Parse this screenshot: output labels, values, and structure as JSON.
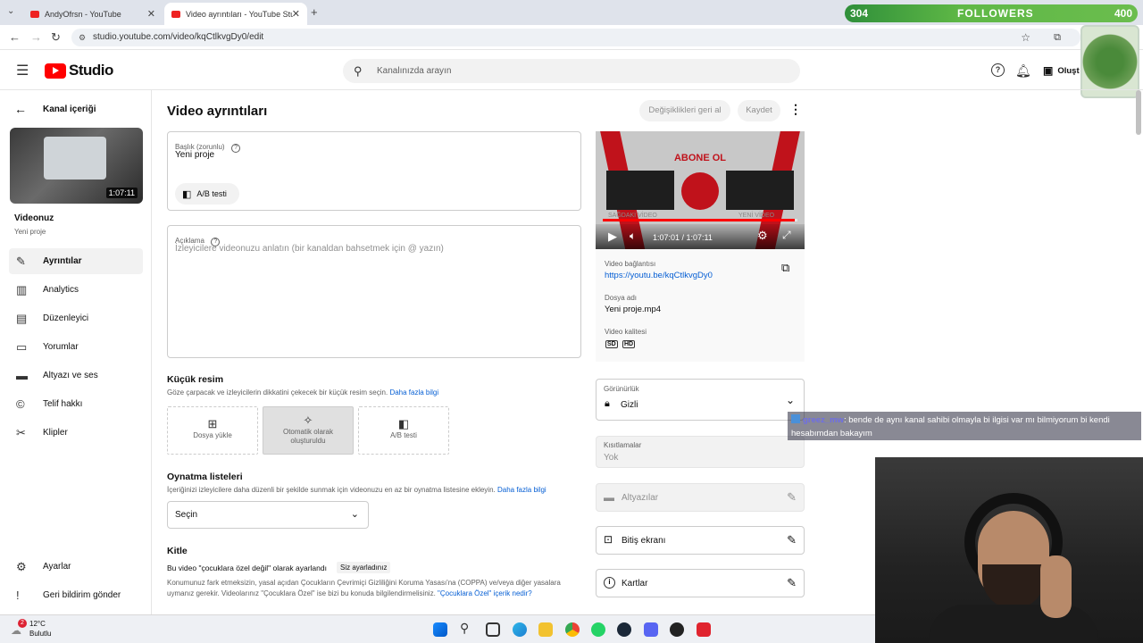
{
  "browser": {
    "tabs": [
      {
        "title": "AndyOfrsn - YouTube"
      },
      {
        "title": "Video ayrıntıları - YouTube Studi"
      }
    ],
    "url": "studio.youtube.com/video/kqCtlkvgDy0/edit"
  },
  "overlay": {
    "followers_count": "304",
    "followers_label": "FOLLOWERS",
    "followers_goal": "400"
  },
  "header": {
    "logo_text": "Studio",
    "search_placeholder": "Kanalınızda arayın",
    "create_label": "Oluşt"
  },
  "sidebar": {
    "back_label": "Kanal içeriği",
    "thumb_duration": "1:07:11",
    "video_title": "Videonuz",
    "video_subtitle": "Yeni proje",
    "items": [
      {
        "label": "Ayrıntılar",
        "icon": "pencil-icon"
      },
      {
        "label": "Analytics",
        "icon": "analytics-icon"
      },
      {
        "label": "Düzenleyici",
        "icon": "editor-icon"
      },
      {
        "label": "Yorumlar",
        "icon": "comments-icon"
      },
      {
        "label": "Altyazı ve ses",
        "icon": "subtitles-icon"
      },
      {
        "label": "Telif hakkı",
        "icon": "copyright-icon"
      },
      {
        "label": "Klipler",
        "icon": "scissors-icon"
      }
    ],
    "settings_label": "Ayarlar",
    "feedback_label": "Geri bildirim gönder"
  },
  "main": {
    "page_title": "Video ayrıntıları",
    "undo_label": "Değişiklikleri geri al",
    "save_label": "Kaydet",
    "title_field_label": "Başlık (zorunlu)",
    "title_value": "Yeni proje",
    "ab_test_label": "A/B testi",
    "description_label": "Açıklama",
    "description_placeholder": "İzleyicilere videonuzu anlatın (bir kanaldan bahsetmek için @ yazın)",
    "thumbnail_title": "Küçük resim",
    "thumbnail_sub": "Göze çarpacak ve izleyicilerin dikkatini çekecek bir küçük resim seçin.",
    "learn_more": "Daha fazla bilgi",
    "thumb_upload_label": "Dosya yükle",
    "thumb_auto_label": "Otomatik olarak oluşturuldu",
    "thumb_ab_label": "A/B testi",
    "playlists_title": "Oynatma listeleri",
    "playlists_sub": "İçeriğinizi izleyicilere daha düzenli bir şekilde sunmak için videonuzu en az bir oynatma listesine ekleyin.",
    "playlists_select": "Seçin",
    "audience_title": "Kitle",
    "audience_status": "Bu video \"çocuklara özel değil\" olarak ayarlandı",
    "audience_badge": "Siz ayarladınız",
    "audience_text": "Konumunuz fark etmeksizin, yasal açıdan Çocukların Çevrimiçi Gizliliğini Koruma Yasası'na (COPPA) ve/veya diğer yasalara uymanız gerekir. Videolarınız \"Çocuklara Özel\" ise bizi bu konuda bilgilendirmelisiniz.",
    "audience_link": "\"Çocuklara Özel\" içerik nedir?"
  },
  "right": {
    "player_overlay_title": "ABONE OL",
    "player_left_caption": "SAĞDAKİ VİDEO",
    "player_right_caption": "YENİ VİDEO",
    "player_time": "1:07:01 / 1:07:11",
    "player_progress": 0.985,
    "video_link_label": "Video bağlantısı",
    "video_link": "https://youtu.be/kqCtlkvgDy0",
    "filename_label": "Dosya adı",
    "filename": "Yeni proje.mp4",
    "quality_label": "Video kalitesi",
    "quality_badges": [
      "SD",
      "HD"
    ],
    "visibility_label": "Görünürlük",
    "visibility_value": "Gizli",
    "restrictions_label": "Kısıtlamalar",
    "restrictions_value": "Yok",
    "subtitles_label": "Altyazılar",
    "endscreen_label": "Bitiş ekranı",
    "cards_label": "Kartlar"
  },
  "chat": {
    "user": "greez_mw",
    "message": ": bende de aynı kanal sahibi olmayla bi ilgisi var mı bilmiyorum bi kendi hesabımdan bakayım"
  },
  "taskbar": {
    "weather_temp": "12°C",
    "weather_desc": "Bulutlu",
    "weather_badge": "2"
  },
  "colors": {
    "yt_red": "#ff0000",
    "link_blue": "#065fd4",
    "followers_green": "#5fb846"
  }
}
